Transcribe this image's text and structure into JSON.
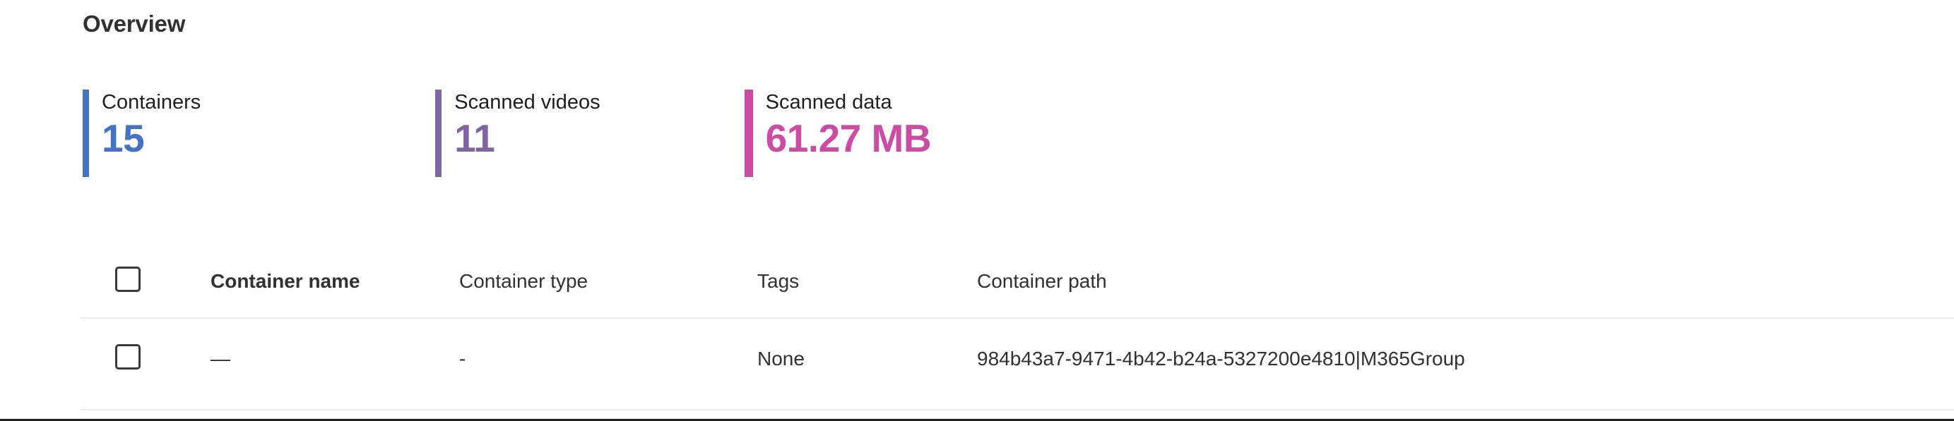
{
  "page": {
    "title": "Overview",
    "background_color": "#ffffff",
    "text_color": "#323130"
  },
  "metrics": [
    {
      "label": "Containers",
      "value": "15",
      "accent_color": "#4472c4",
      "accent_name": "blue"
    },
    {
      "label": "Scanned videos",
      "value": "11",
      "accent_color": "#8064a2",
      "accent_name": "purple"
    },
    {
      "label": "Scanned data",
      "value": "61.27 MB",
      "accent_color": "#cc4ba5",
      "accent_name": "magenta"
    }
  ],
  "table": {
    "select_all_checkbox": {
      "checked": false,
      "icon": "checkbox-unchecked-icon"
    },
    "columns": [
      {
        "key": "name",
        "label": "Container name",
        "sorted": true
      },
      {
        "key": "type",
        "label": "Container type",
        "sorted": false
      },
      {
        "key": "tags",
        "label": "Tags",
        "sorted": false
      },
      {
        "key": "path",
        "label": "Container path",
        "sorted": false
      }
    ],
    "rows": [
      {
        "selected": false,
        "checkbox_icon": "checkbox-unchecked-icon",
        "name": "—",
        "type": "-",
        "tags": "None",
        "path": "984b43a7-9471-4b42-b24a-5327200e4810|M365Group"
      }
    ],
    "divider_color": "#edebe9"
  }
}
